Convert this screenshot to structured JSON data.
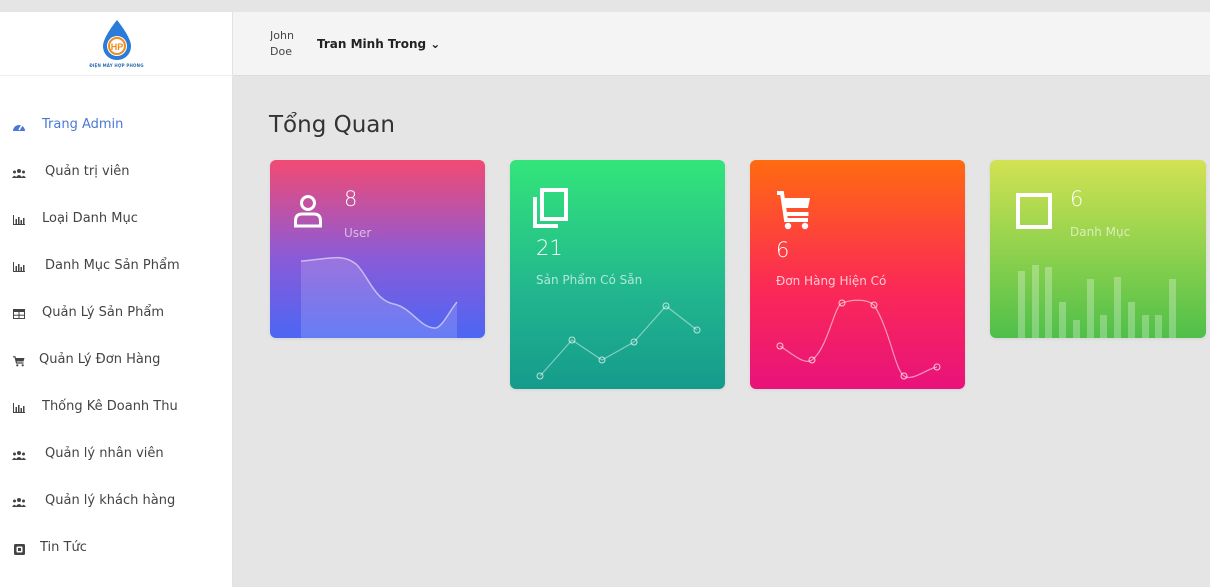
{
  "sidebar": {
    "logo": {
      "initials": "HP",
      "caption": "ĐIỆN MÁY HỢP PHONG"
    },
    "items": [
      {
        "label": "Trang Admin",
        "icon": "dashboard-icon",
        "active": true
      },
      {
        "label": "Quản trị viên",
        "icon": "users-icon"
      },
      {
        "label": "Loại Danh Mục",
        "icon": "bar-chart-icon"
      },
      {
        "label": "Danh Mục Sản Phẩm",
        "icon": "bar-chart-icon"
      },
      {
        "label": "Quản Lý Sản Phẩm",
        "icon": "table-icon"
      },
      {
        "label": "Quản Lý Đơn Hàng",
        "icon": "cart-icon"
      },
      {
        "label": "Thống Kê Doanh Thu",
        "icon": "bar-chart-icon"
      },
      {
        "label": "Quản lý nhân viên",
        "icon": "users-icon"
      },
      {
        "label": "Quản lý khách hàng",
        "icon": "users-icon"
      },
      {
        "label": "Tin Tức",
        "icon": "news-icon"
      }
    ]
  },
  "header": {
    "left_text": "John Doe",
    "user_name": "Tran Minh Trong",
    "dropdown_caret": "⌄"
  },
  "page": {
    "title": "Tổng Quan"
  },
  "cards": [
    {
      "value": "8",
      "label": "User",
      "icon": "user-icon"
    },
    {
      "value": "21",
      "label": "Sản Phẩm Có Sẵn",
      "icon": "copy-icon"
    },
    {
      "value": "6",
      "label": "Đơn Hàng Hiện Có",
      "icon": "cart-icon"
    },
    {
      "value": "6",
      "label": "Danh Mục",
      "icon": "square-icon"
    }
  ],
  "colors": {
    "accent": "#4a78d6",
    "card_user": "#f24a73",
    "card_product": "#33e57a",
    "card_order": "#ff6b10",
    "card_category": "#8ad04d"
  }
}
